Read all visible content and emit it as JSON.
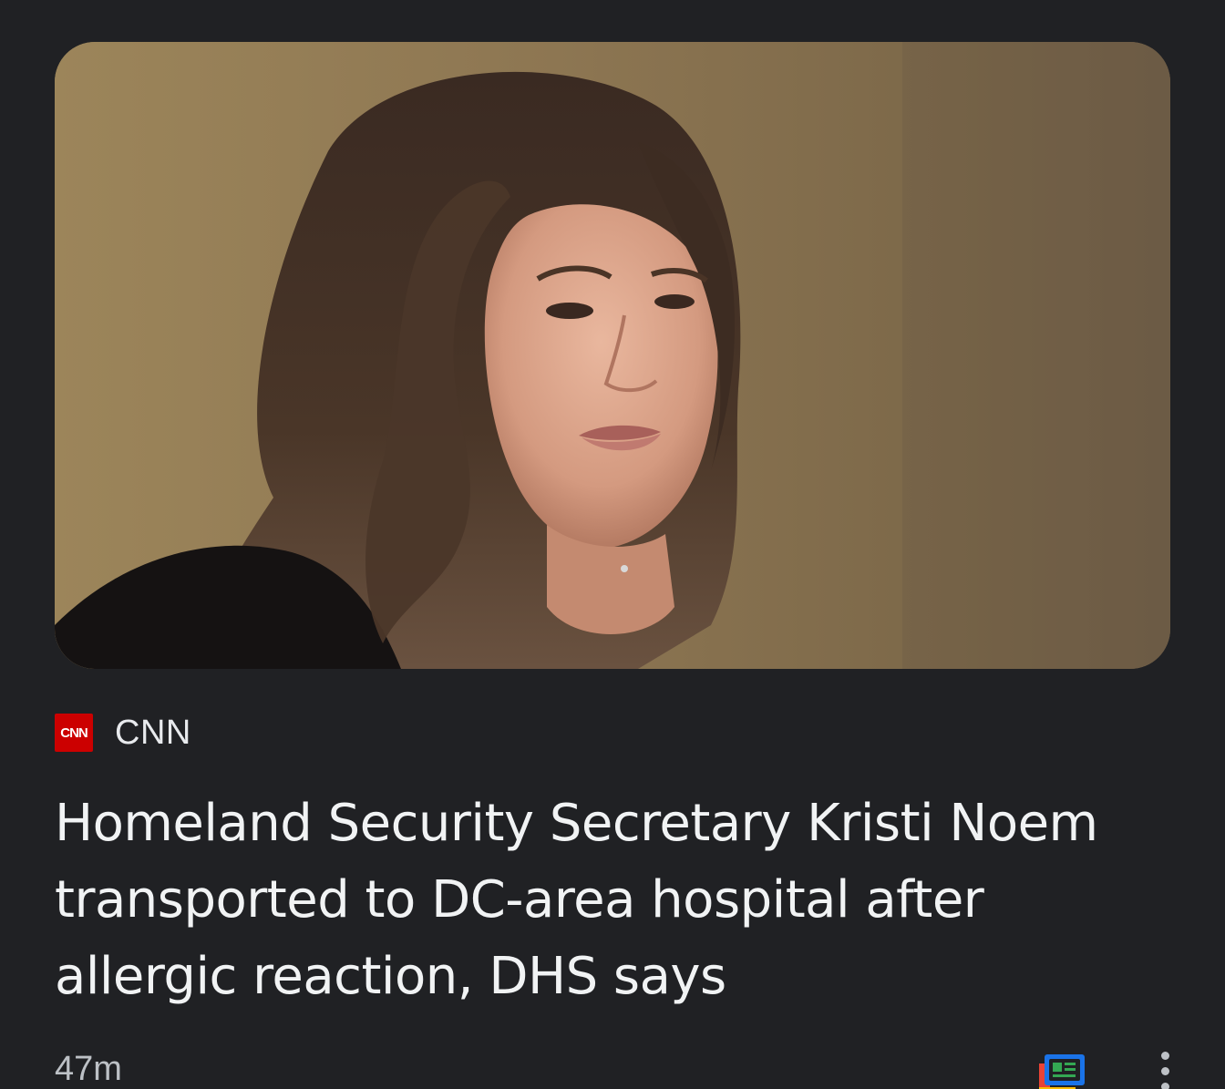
{
  "article": {
    "image_alt": "Kristi Noem",
    "source": {
      "logo_text": "CNN",
      "name": "CNN"
    },
    "headline": "Homeland Security Secretary Kristi Noem transported to DC-area hospital after allergic reaction, DHS says",
    "time": "47m"
  },
  "icons": {
    "source_logo": "cnn-logo-icon",
    "full_coverage": "google-news-icon",
    "menu": "more-vert-icon"
  },
  "colors": {
    "background": "#202124",
    "text_primary": "#f1f3f4",
    "text_secondary": "#bdc1c6",
    "cnn_red": "#cc0000"
  }
}
